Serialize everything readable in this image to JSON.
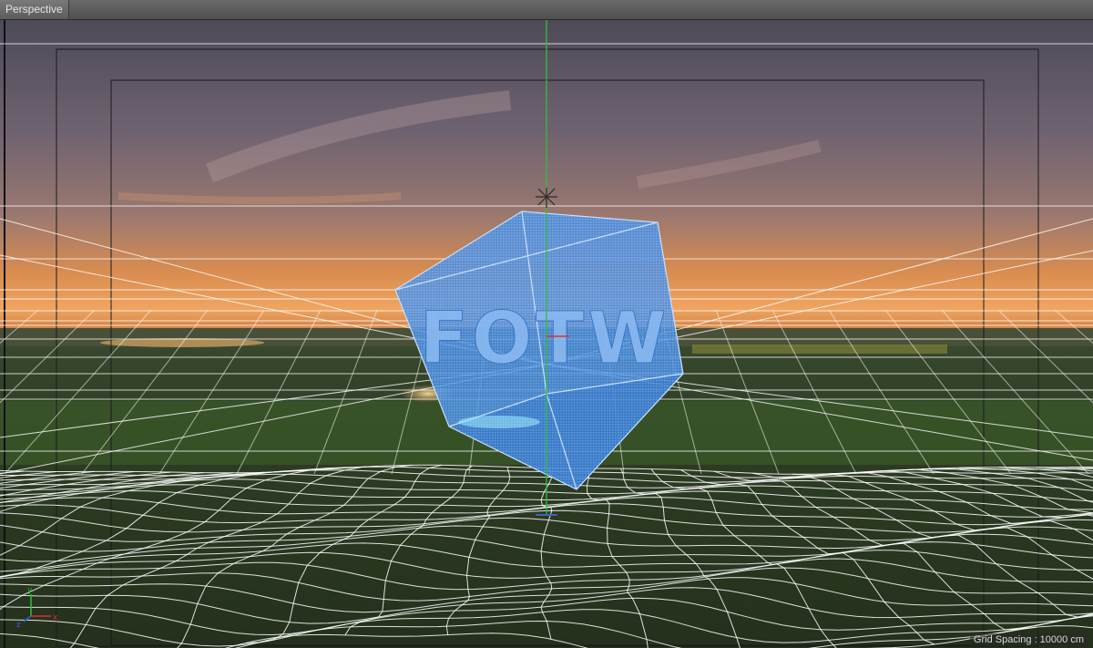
{
  "viewport": {
    "name": "Perspective",
    "grid_spacing_label": "Grid Spacing : 10000 cm"
  },
  "scene": {
    "object_text": "FOTW"
  },
  "axis_gizmo": {
    "x_label": "x",
    "y_label": "y",
    "z_label": "z"
  },
  "colors": {
    "sky_top": "#5b5565",
    "sky_mid": "#8a7478",
    "horizon_glow": "#e89a55",
    "ground": "#2f3f25",
    "cube_fill": "#4a90e8",
    "grid_lines": "#ffffff",
    "y_axis": "#2fbf3a",
    "x_axis": "#d83030",
    "z_axis": "#3060e0"
  }
}
